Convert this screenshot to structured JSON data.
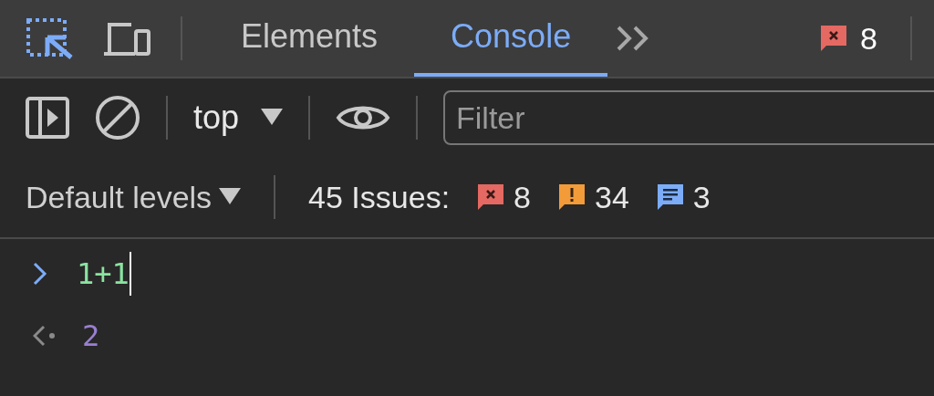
{
  "toolbar": {
    "tabs": [
      {
        "label": "Elements",
        "selected": false
      },
      {
        "label": "Console",
        "selected": true
      }
    ],
    "error_count": "8"
  },
  "console_toolbar": {
    "context": "top",
    "filter": {
      "placeholder": "Filter"
    }
  },
  "levels": {
    "label": "Default levels",
    "issues_label": "45 Issues:",
    "issues": [
      {
        "kind": "error",
        "count": "8"
      },
      {
        "kind": "warning",
        "count": "34"
      },
      {
        "kind": "info",
        "count": "3"
      }
    ]
  },
  "console": [
    {
      "kind": "input",
      "text": "1+1"
    },
    {
      "kind": "result",
      "text": "2"
    }
  ]
}
